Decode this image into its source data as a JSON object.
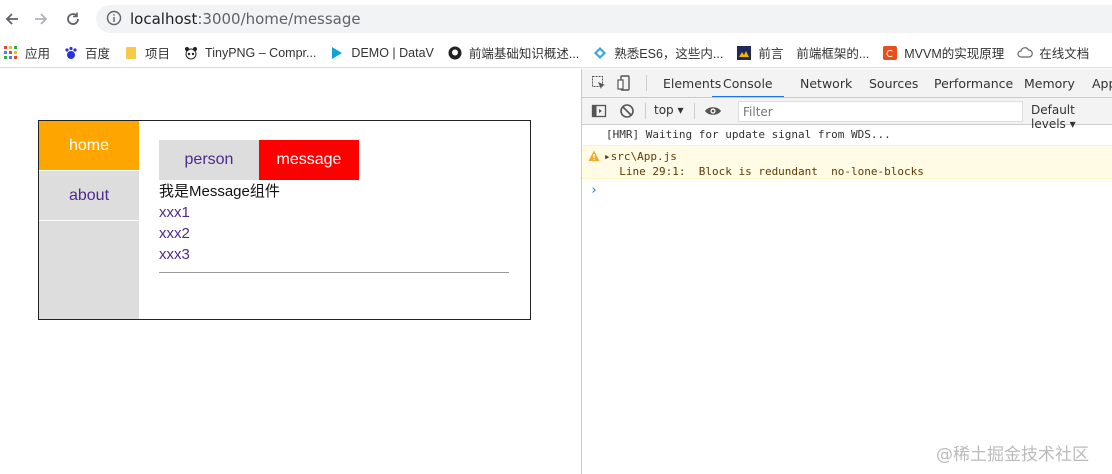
{
  "browser": {
    "url_host": "localhost",
    "url_path": ":3000/home/message",
    "bookmarks": [
      {
        "label": "应用",
        "icon": "apps-grid-icon"
      },
      {
        "label": "百度",
        "icon": "baidu-paw-icon"
      },
      {
        "label": "项目",
        "icon": "folder-icon"
      },
      {
        "label": "TinyPNG – Compr...",
        "icon": "panda-icon"
      },
      {
        "label": "DEMO | DataV",
        "icon": "datav-icon"
      },
      {
        "label": "前端基础知识概述...",
        "icon": "github-icon"
      },
      {
        "label": "熟悉ES6，这些内...",
        "icon": "diamond-icon"
      },
      {
        "label": "前言",
        "icon": "book-icon"
      },
      {
        "label": "前端框架的...",
        "icon": ""
      },
      {
        "label": "MVVM的实现原理",
        "icon": "csdn-c-icon"
      },
      {
        "label": "在线文档",
        "icon": "cloud-icon"
      }
    ]
  },
  "app": {
    "nav": {
      "home": "home",
      "about": "about"
    },
    "tabs": {
      "person": "person",
      "message": "message"
    },
    "message_title": "我是Message组件",
    "messages": [
      "xxx1",
      "xxx2",
      "xxx3"
    ]
  },
  "devtools": {
    "tabs": [
      "Elements",
      "Console",
      "Network",
      "Sources",
      "Performance",
      "Memory",
      "App"
    ],
    "context": "top",
    "filter_placeholder": "Filter",
    "levels": "Default levels",
    "log_hmr": "[HMR] Waiting for update signal from WDS...",
    "warn_file": "src\\App.js",
    "warn_detail": "  Line 29:1:  Block is redundant  no-lone-blocks",
    "prompt": "›"
  },
  "watermark": "@稀土掘金技术社区",
  "colors": {
    "accent_orange": "#ffa500",
    "active_red": "#ff0000",
    "link_purple": "#502a8c",
    "devtools_blue": "#1a73e8"
  }
}
